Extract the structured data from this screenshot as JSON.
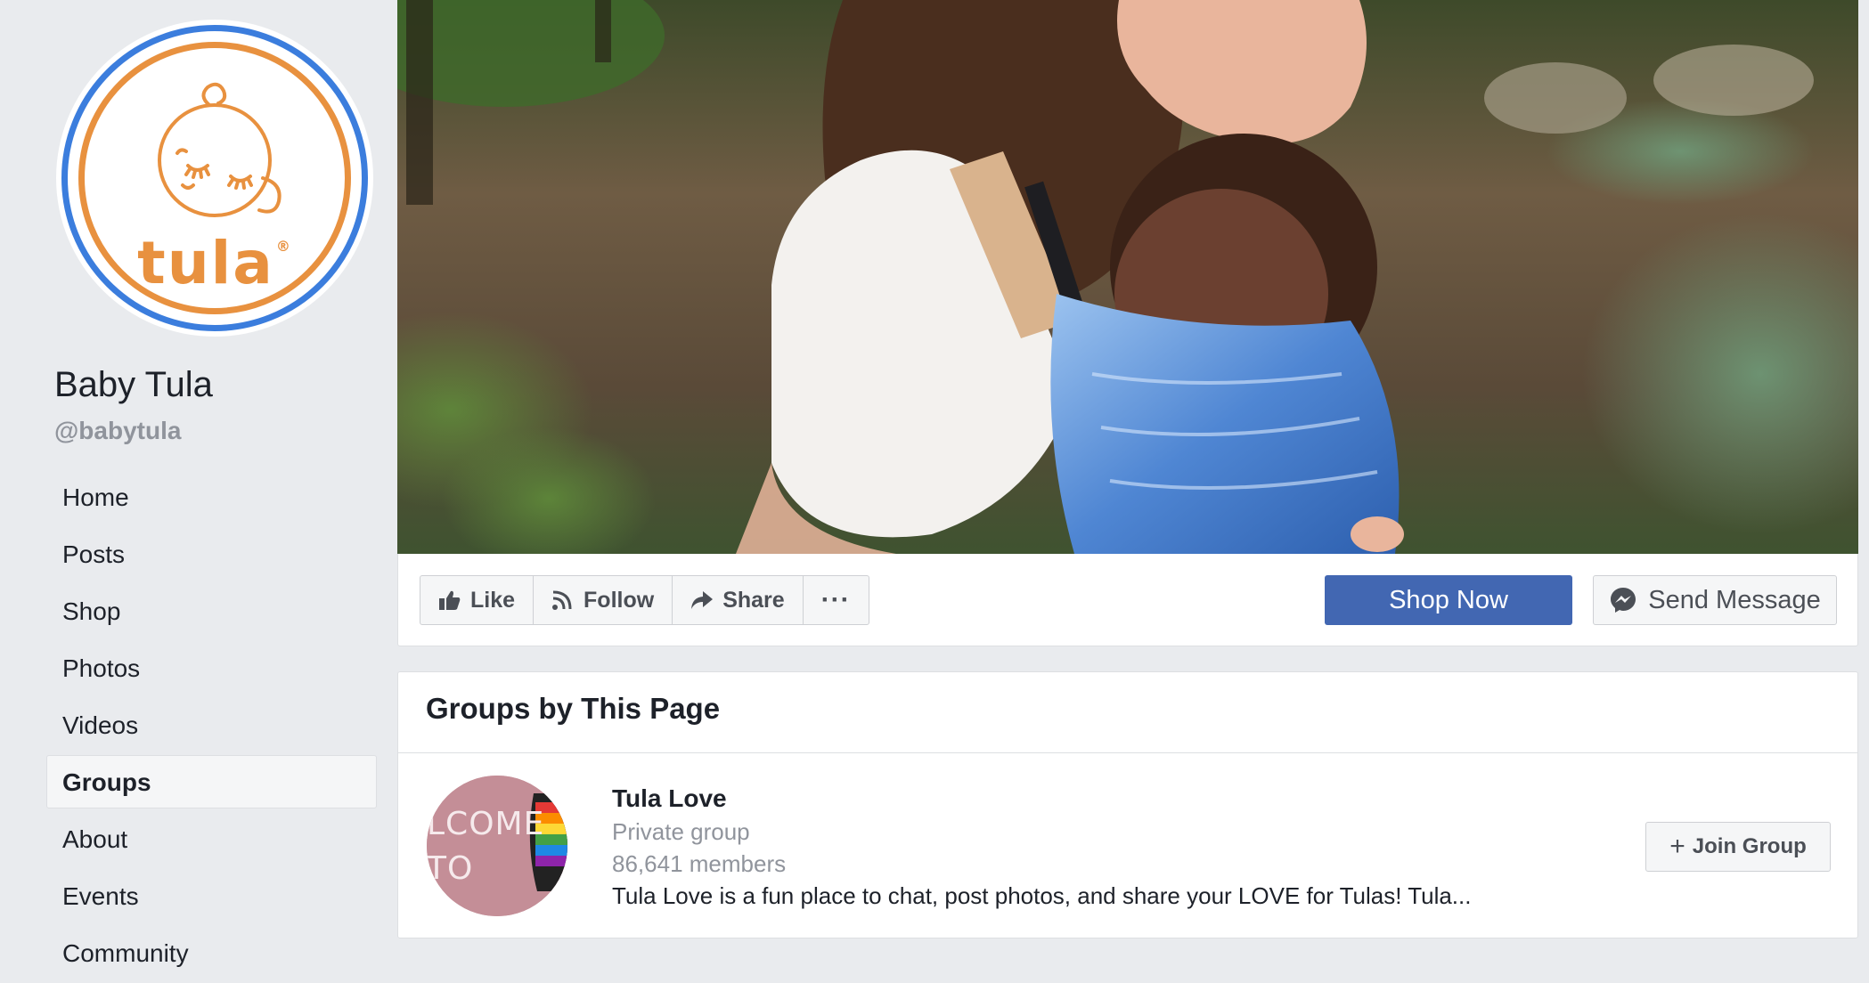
{
  "page": {
    "name": "Baby Tula",
    "handle": "@babytula"
  },
  "logo": {
    "wordmark": "tula",
    "mark": "®"
  },
  "nav": {
    "items": [
      {
        "label": "Home"
      },
      {
        "label": "Posts"
      },
      {
        "label": "Shop"
      },
      {
        "label": "Photos"
      },
      {
        "label": "Videos"
      },
      {
        "label": "Groups",
        "active": true
      },
      {
        "label": "About"
      },
      {
        "label": "Events"
      },
      {
        "label": "Community"
      }
    ]
  },
  "actions": {
    "like": "Like",
    "follow": "Follow",
    "share": "Share",
    "more": "···",
    "shop_now": "Shop Now",
    "send_message": "Send Message"
  },
  "groups": {
    "title": "Groups by This Page",
    "items": [
      {
        "name": "Tula Love",
        "privacy": "Private group",
        "members": "86,641 members",
        "description": "Tula Love is a fun place to chat, post photos, and share your LOVE for Tulas! Tula...",
        "photo_text": "LCOME TO",
        "join_label": "Join Group"
      }
    ]
  },
  "colors": {
    "brand_orange": "#e8913f",
    "ring_blue": "#3b7ddd",
    "primary_button": "#4267b2",
    "background": "#e9ebee"
  },
  "icons": [
    "thumbs-up-icon",
    "rss-icon",
    "share-arrow-icon",
    "more-dots-icon",
    "messenger-icon",
    "plus-icon"
  ]
}
